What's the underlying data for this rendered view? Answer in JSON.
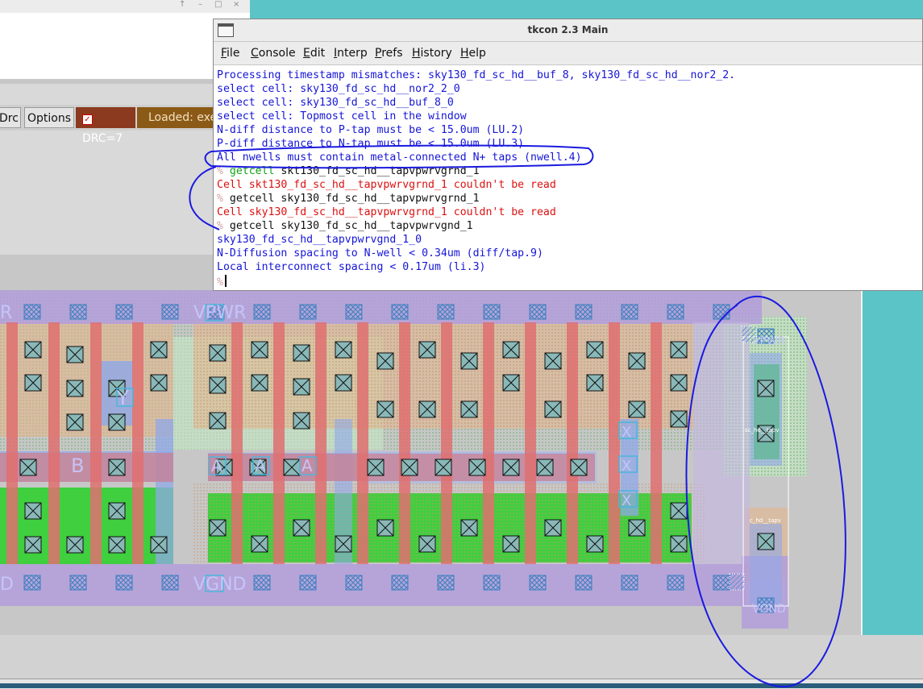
{
  "back_window": {
    "controls": [
      "↑",
      "–",
      "□",
      "×"
    ],
    "toolbar": {
      "drc_button": "Drc",
      "options_button": "Options",
      "drc_count": "DRC=7",
      "loaded_text": "Loaded: exe"
    }
  },
  "tkcon": {
    "title": "tkcon 2.3 Main",
    "menu": {
      "file": {
        "u": "F",
        "rest": "ile"
      },
      "console": {
        "u": "C",
        "rest": "onsole"
      },
      "edit": {
        "u": "E",
        "rest": "dit"
      },
      "interp": {
        "u": "I",
        "rest": "nterp"
      },
      "prefs": {
        "u": "P",
        "rest": "refs"
      },
      "history": {
        "u": "H",
        "rest": "istory"
      },
      "help": {
        "u": "H",
        "rest": "elp"
      }
    },
    "lines": {
      "l0": "Processing timestamp mismatches: sky130_fd_sc_hd__buf_8, sky130_fd_sc_hd__nor2_2.",
      "l1": "select cell: sky130_fd_sc_hd__nor2_2_0",
      "l2": "select cell: sky130_fd_sc_hd__buf_8_0",
      "l3": "select cell: Topmost cell in the window",
      "l4": "N-diff distance to P-tap must be < 15.0um (LU.2)",
      "l5": "P-diff distance to N-tap must be < 15.0um (LU.3)",
      "l6": "All nwells must contain metal-connected N+ taps (nwell.4)",
      "l7_prompt": "%",
      "l7_cmd": "getcell",
      "l7_arg": " skt130_fd_sc_hd__tapvpwrvgrnd_1",
      "l8": "Cell skt130_fd_sc_hd__tapvpwrvgrnd_1 couldn't be read",
      "l9_prompt": "%",
      "l9_cmd": " getcell sky130_fd_sc_hd__tapvpwrvgrnd_1",
      "l10": "Cell sky130_fd_sc_hd__tapvpwrvgrnd_1 couldn't be read",
      "l11_prompt": "%",
      "l11_cmd": " getcell sky130_fd_sc_hd__tapvpwrvgnd_1",
      "l12": "sky130_fd_sc_hd__tapvpwrvgnd_1_0",
      "l13": "N-Diffusion spacing to N-well < 0.34um (diff/tap.9)",
      "l14": "Local interconnect spacing < 0.17um (li.3)",
      "l15_prompt": "%"
    }
  },
  "layout_labels": {
    "vpwr": "VPWR",
    "vgnd": "VGND",
    "vpwr_left": "R",
    "vgnd_left": "D",
    "y": "Y",
    "b": "B",
    "a1": "A",
    "a2": "A",
    "a3": "A",
    "x1": "X",
    "x2": "X",
    "x3": "X",
    "tap_vpwr": "VPWR",
    "tap_vgnd": "VGND",
    "tap_label_top": "sc_hd__tapv",
    "tap_label_bot": "c_hd__tapv"
  },
  "colors": {
    "annotation": "#1a1ae0",
    "nwell": "#7fbf7f",
    "poly": "#e07070",
    "diff": "#3fcf3f",
    "ndiff_tint": "#5bbf9f",
    "li": "#b39ddb",
    "met1": "#8fa8e8",
    "contact_fill": "#8ab8b8"
  }
}
